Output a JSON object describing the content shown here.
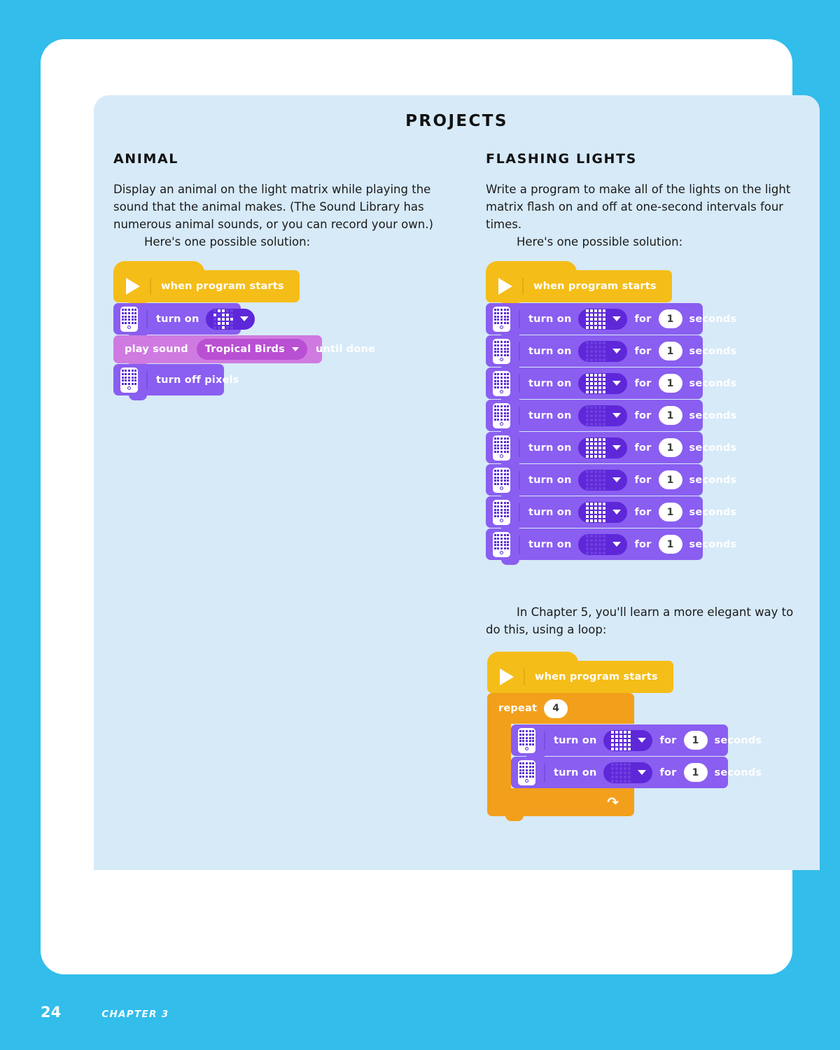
{
  "theme": {
    "outer_bg": "#32bdeb",
    "sheet_bg": "#ffffff",
    "panel_bg": "#d7eaf8",
    "hat_block": "#f5bd18",
    "light_block": "#8a5ef0",
    "sound_block": "#cf7ae0",
    "repeat_block": "#f2a01c",
    "text": "#121212"
  },
  "page": {
    "title": "PROJECTS",
    "footer_number": "24",
    "footer_chapter": "CHAPTER 3"
  },
  "left_column": {
    "heading": "ANIMAL",
    "paragraph": "Display an animal on the light matrix while playing the sound that the animal makes. (The Sound Library has numerous animal sounds, or you can record your own.)",
    "solution_lead": "Here's one possible solution:",
    "program": {
      "hat_label": "when program starts",
      "blocks": [
        {
          "type": "turn-on-matrix",
          "label": "turn on",
          "matrix": "animal"
        },
        {
          "type": "play-sound",
          "label_before": "play sound",
          "sound": "Tropical Birds",
          "label_after": "until done"
        },
        {
          "type": "turn-off-pixels",
          "label": "turn off pixels"
        }
      ]
    }
  },
  "right_column": {
    "heading": "FLASHING LIGHTS",
    "paragraph": "Write a program to make all of the lights on the light matrix flash on and off at one-second intervals four times.",
    "solution_lead": "Here's one possible solution:",
    "program": {
      "hat_label": "when program starts",
      "blocks": [
        {
          "label": "turn on",
          "matrix": "all-on",
          "for_label": "for",
          "seconds": "1",
          "seconds_label": "seconds"
        },
        {
          "label": "turn on",
          "matrix": "all-off",
          "for_label": "for",
          "seconds": "1",
          "seconds_label": "seconds"
        },
        {
          "label": "turn on",
          "matrix": "all-on",
          "for_label": "for",
          "seconds": "1",
          "seconds_label": "seconds"
        },
        {
          "label": "turn on",
          "matrix": "all-off",
          "for_label": "for",
          "seconds": "1",
          "seconds_label": "seconds"
        },
        {
          "label": "turn on",
          "matrix": "all-on",
          "for_label": "for",
          "seconds": "1",
          "seconds_label": "seconds"
        },
        {
          "label": "turn on",
          "matrix": "all-off",
          "for_label": "for",
          "seconds": "1",
          "seconds_label": "seconds"
        },
        {
          "label": "turn on",
          "matrix": "all-on",
          "for_label": "for",
          "seconds": "1",
          "seconds_label": "seconds"
        },
        {
          "label": "turn on",
          "matrix": "all-off",
          "for_label": "for",
          "seconds": "1",
          "seconds_label": "seconds"
        }
      ]
    },
    "loop_note": "In Chapter 5, you'll learn a more elegant way to do this, using a loop:",
    "loop_program": {
      "hat_label": "when program starts",
      "repeat_label": "repeat",
      "repeat_count": "4",
      "blocks": [
        {
          "label": "turn on",
          "matrix": "all-on",
          "for_label": "for",
          "seconds": "1",
          "seconds_label": "seconds"
        },
        {
          "label": "turn on",
          "matrix": "all-off",
          "for_label": "for",
          "seconds": "1",
          "seconds_label": "seconds"
        }
      ]
    }
  }
}
